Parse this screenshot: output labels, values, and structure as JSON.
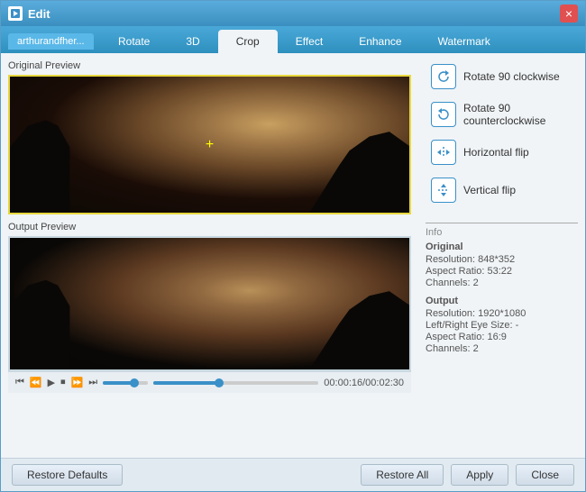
{
  "window": {
    "title": "Edit",
    "close_label": "×"
  },
  "file_tab": {
    "label": "arthurandfher..."
  },
  "tabs": [
    {
      "label": "Rotate",
      "active": false
    },
    {
      "label": "3D",
      "active": false
    },
    {
      "label": "Crop",
      "active": true
    },
    {
      "label": "Effect",
      "active": false
    },
    {
      "label": "Enhance",
      "active": false
    },
    {
      "label": "Watermark",
      "active": false
    }
  ],
  "original_preview_label": "Original Preview",
  "output_preview_label": "Output Preview",
  "actions": [
    {
      "label": "Rotate 90 clockwise",
      "icon": "↻"
    },
    {
      "label": "Rotate 90 counterclockwise",
      "icon": "↺"
    },
    {
      "label": "Horizontal flip",
      "icon": "⇔"
    },
    {
      "label": "Vertical flip",
      "icon": "⇕"
    }
  ],
  "info": {
    "section_label": "Info",
    "original_label": "Original",
    "original_resolution": "Resolution: 848*352",
    "original_aspect": "Aspect Ratio: 53:22",
    "original_channels": "Channels: 2",
    "output_label": "Output",
    "output_resolution": "Resolution: 1920*1080",
    "output_lr_size": "Left/Right Eye Size: -",
    "output_aspect": "Aspect Ratio: 16:9",
    "output_channels": "Channels: 2"
  },
  "playback": {
    "time": "00:00:16/00:02:30"
  },
  "buttons": {
    "restore_defaults": "Restore Defaults",
    "restore_all": "Restore All",
    "apply": "Apply",
    "close": "Close"
  }
}
